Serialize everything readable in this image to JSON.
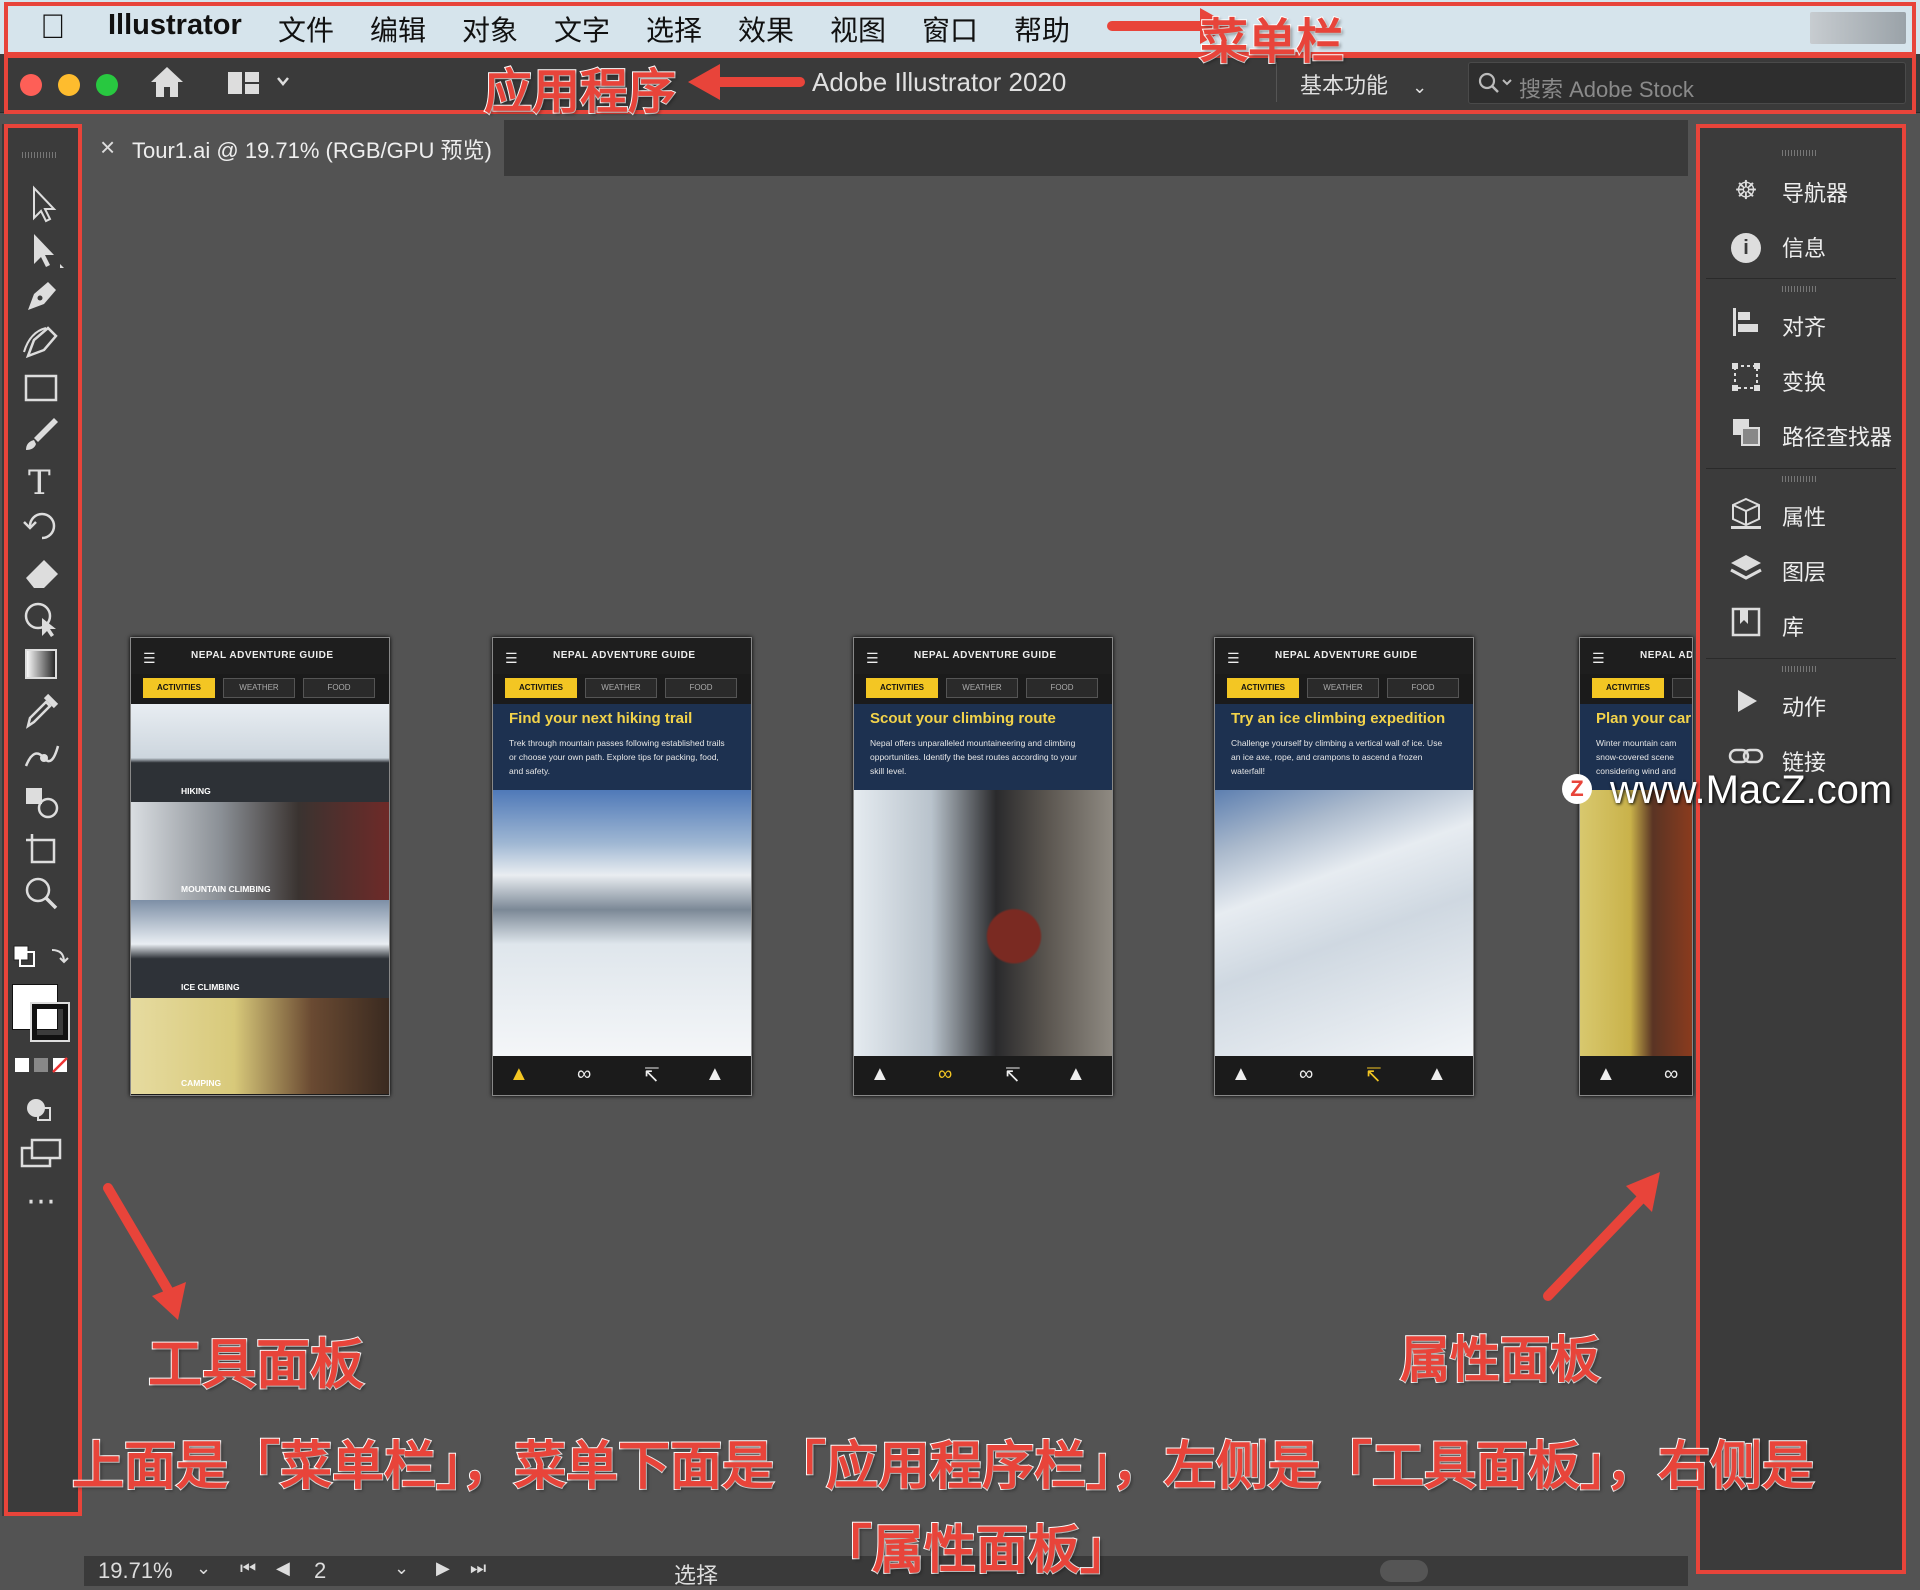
{
  "menubar": {
    "apple_icon": "apple-logo-icon",
    "app_name": "Illustrator",
    "items": [
      "文件",
      "编辑",
      "对象",
      "文字",
      "选择",
      "效果",
      "视图",
      "窗口",
      "帮助"
    ]
  },
  "appbar": {
    "title": "Adobe Illustrator 2020",
    "workspace": "基本功能",
    "search_placeholder": "搜索 Adobe Stock"
  },
  "document_tab": {
    "close": "×",
    "name": "Tour1.ai @ 19.71% (RGB/GPU 预览)"
  },
  "artboards": [
    {
      "header": "NEPAL ADVENTURE GUIDE",
      "tabs": [
        "ACTIVITIES",
        "WEATHER",
        "FOOD"
      ],
      "list": [
        "HIKING",
        "MOUNTAIN CLIMBING",
        "ICE CLIMBING",
        "CAMPING"
      ]
    },
    {
      "header": "NEPAL ADVENTURE GUIDE",
      "tabs": [
        "ACTIVITIES",
        "WEATHER",
        "FOOD"
      ],
      "heading": "Find your next hiking trail",
      "body": "Trek through mountain passes following established trails or choose your own path. Explore tips for packing, food, and safety."
    },
    {
      "header": "NEPAL ADVENTURE GUIDE",
      "tabs": [
        "ACTIVITIES",
        "WEATHER",
        "FOOD"
      ],
      "heading": "Scout your climbing route",
      "body": "Nepal offers unparalleled mountaineering and climbing opportunities. Identify the best routes according to your skill level."
    },
    {
      "header": "NEPAL ADVENTURE GUIDE",
      "tabs": [
        "ACTIVITIES",
        "WEATHER",
        "FOOD"
      ],
      "heading": "Try an ice climbing expedition",
      "body": "Challenge yourself by climbing a vertical wall of ice. Use an ice axe, rope, and crampons to ascend a frozen waterfall!"
    },
    {
      "header": "NEPAL AD",
      "tabs": [
        "ACTIVITIES",
        "W"
      ],
      "heading": "Plan your car",
      "body": "Winter mountain cam snow-covered scene considering wind and"
    }
  ],
  "right_panel": {
    "groups": [
      [
        {
          "icon": "navigator-icon",
          "label": "导航器"
        },
        {
          "icon": "info-icon",
          "label": "信息"
        }
      ],
      [
        {
          "icon": "align-icon",
          "label": "对齐"
        },
        {
          "icon": "transform-icon",
          "label": "变换"
        },
        {
          "icon": "pathfinder-icon",
          "label": "路径查找器"
        }
      ],
      [
        {
          "icon": "properties-icon",
          "label": "属性"
        },
        {
          "icon": "layers-icon",
          "label": "图层"
        },
        {
          "icon": "libraries-icon",
          "label": "库"
        }
      ],
      [
        {
          "icon": "play-icon",
          "label": "动作"
        },
        {
          "icon": "link-icon",
          "label": "链接"
        }
      ]
    ]
  },
  "status": {
    "zoom": "19.71%",
    "artboard": "2",
    "tool": "选择"
  },
  "annotations": {
    "menubar": "菜单栏",
    "appbar": "应用程序",
    "tools": "工具面板",
    "properties": "属性面板",
    "caption_line1": "上面是「菜单栏」，菜单下面是「应用程序栏」，左侧是「工具面板」，右侧是",
    "caption_line2": "「属性面板」",
    "watermark": "www.MacZ.com"
  },
  "colors": {
    "annotation_red": "#e8443a",
    "accent_yellow": "#f3c623",
    "traffic_red": "#fe5f57",
    "traffic_yellow": "#febc2e",
    "traffic_green": "#28c840"
  }
}
